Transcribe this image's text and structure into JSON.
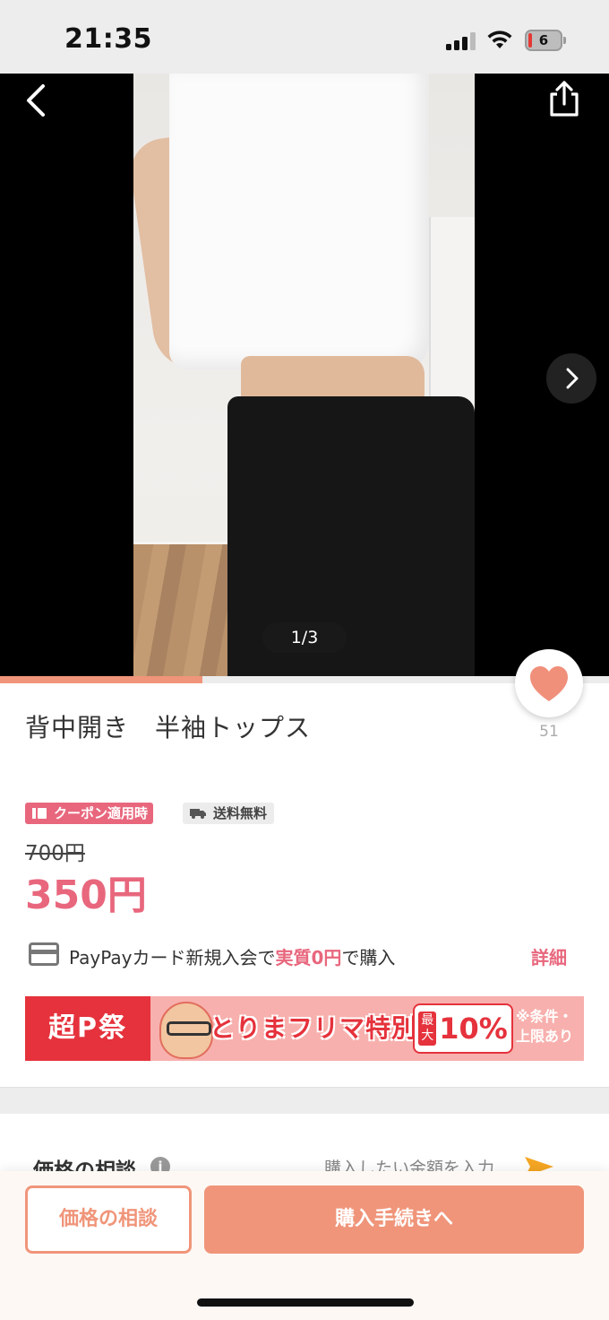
{
  "status_bar": {
    "time": "21:35",
    "battery": "6"
  },
  "gallery": {
    "page_indicator": "1/3",
    "progress": 0.333
  },
  "item": {
    "title": "背中開き　半袖トップス",
    "like_count": "51",
    "coupon_badge": "クーポン適用時",
    "shipping_badge": "送料無料",
    "original_price": "700円",
    "sale_price": "350円"
  },
  "paypay": {
    "text_before": "PayPayカード新規入会で",
    "highlight": "実質0円",
    "text_after": "で購入",
    "detail_link": "詳細"
  },
  "promo_banner": {
    "left_label": "超P祭",
    "headline": "とりまフリマ特別版",
    "max_label": "最大",
    "rate": "10%",
    "note_line1": "※条件・",
    "note_line2": "上限あり"
  },
  "negotiation": {
    "title": "価格の相談",
    "hint": "購入したい金額を入力"
  },
  "bottom_bar": {
    "negotiate_label": "価格の相談",
    "buy_label": "購入手続きへ"
  },
  "colors": {
    "accent": "#f0957a",
    "price_pink": "#e8677d",
    "promo_red": "#e5323c"
  },
  "icons": [
    "back-arrow-icon",
    "share-icon",
    "chevron-right-icon",
    "heart-icon",
    "coupon-icon",
    "truck-icon",
    "credit-card-icon",
    "info-icon",
    "send-arrow-icon"
  ]
}
